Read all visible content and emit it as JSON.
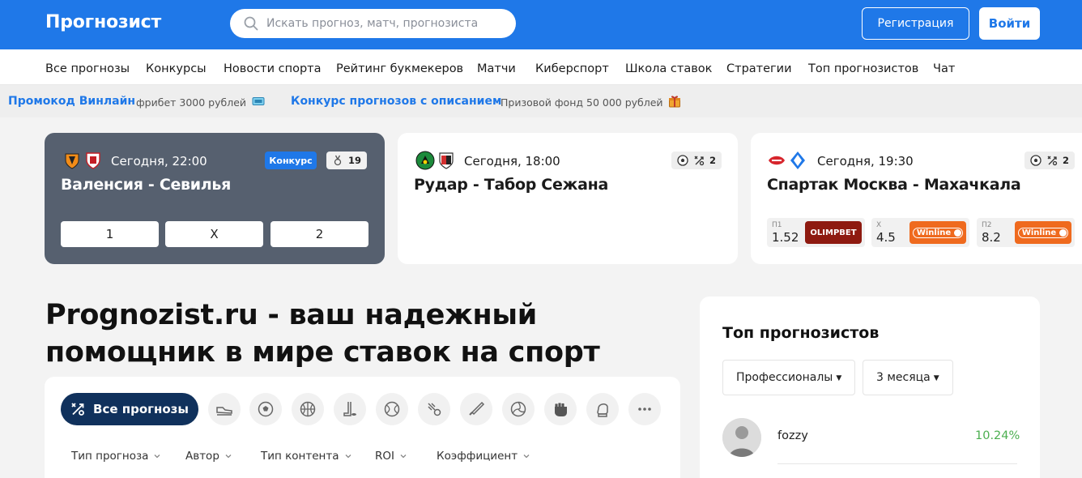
{
  "header": {
    "logo": "Прогнозист",
    "search_placeholder": "Искать прогноз, матч, прогнозиста",
    "register_label": "Регистрация",
    "login_label": "Войти"
  },
  "nav": {
    "items": [
      {
        "label": "Все прогнозы"
      },
      {
        "label": "Конкурсы"
      },
      {
        "label": "Новости спорта"
      },
      {
        "label": "Рейтинг букмекеров"
      },
      {
        "label": "Матчи"
      },
      {
        "label": "Киберспорт"
      },
      {
        "label": "Школа ставок"
      },
      {
        "label": "Стратегии"
      },
      {
        "label": "Топ прогнозистов"
      },
      {
        "label": "Чат"
      }
    ]
  },
  "promo": {
    "items": [
      {
        "title": "Промокод Винлайн",
        "subtitle": "фрибет 3000 рублей",
        "icon": "ticket-icon"
      },
      {
        "title": "Конкурс прогнозов с описанием",
        "subtitle": "Призовой фонд 50 000 рублей",
        "icon": "gift-icon"
      }
    ]
  },
  "matches": [
    {
      "time": "Сегодня, 22:00",
      "title": "Валенсия - Севилья",
      "badge": "Конкурс",
      "count": "19",
      "outcomes": [
        "1",
        "X",
        "2"
      ]
    },
    {
      "time": "Сегодня, 18:00",
      "title": "Рудар - Табор Сежана",
      "count": "2"
    },
    {
      "time": "Сегодня, 19:30",
      "title": "Спартак Москва - Махачкала",
      "count": "2",
      "odds": [
        {
          "label": "П1",
          "value": "1.52",
          "bookmaker": "OLIMPBET"
        },
        {
          "label": "X",
          "value": "4.5",
          "bookmaker": "Winline"
        },
        {
          "label": "П2",
          "value": "8.2",
          "bookmaker": "Winline"
        }
      ]
    }
  ],
  "hero": {
    "title": "Prognozist.ru - ваш надежный помощник в мире ставок на спорт"
  },
  "filters": {
    "all_label": "Все прогнозы",
    "sports": [
      "football-boot-icon",
      "football-icon",
      "basketball-icon",
      "hockey-icon",
      "tennis-icon",
      "badminton-icon",
      "baseball-icon",
      "volleyball-icon",
      "fist-icon",
      "boxing-glove-icon",
      "more-icon"
    ],
    "dropdowns": [
      {
        "label": "Тип прогноза"
      },
      {
        "label": "Автор"
      },
      {
        "label": "Тип контента"
      },
      {
        "label": "ROI"
      },
      {
        "label": "Коэффициент"
      }
    ]
  },
  "top": {
    "title": "Топ прогнозистов",
    "category": "Профессионалы",
    "period": "3 месяца",
    "users": [
      {
        "name": "fozzy",
        "roi": "10.24%"
      }
    ]
  },
  "colors": {
    "brand": "#1f78e8",
    "dark_card": "#56606f",
    "navy": "#10315c",
    "positive": "#4caf50"
  }
}
